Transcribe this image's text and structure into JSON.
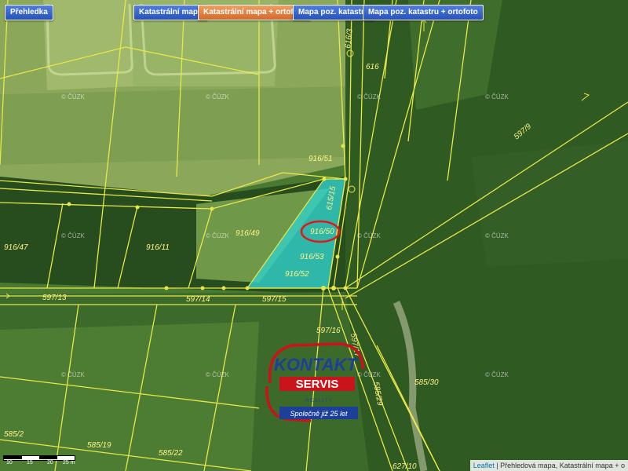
{
  "buttons": {
    "overview": "Přehledka",
    "cadastral": "Katastrální mapa",
    "cadastral_ortho": "Katastrální mapa + ortofoto",
    "cadastral_pos": "Mapa poz. katastru",
    "cadastral_pos_ortho": "Mapa poz. katastru + ortofoto"
  },
  "parcels": [
    "616/3",
    "616",
    "916/51",
    "615/15",
    "916/49",
    "916/50",
    "916/47",
    "916/11",
    "916/53",
    "916/52",
    "597/13",
    "597/14",
    "597/15",
    "597/16",
    "597/9",
    "597/17",
    "585/29",
    "585/30",
    "585/2",
    "585/19",
    "585/22",
    "627/10"
  ],
  "watermark": "© ČÚZK",
  "logo": {
    "line1": "KONTAKT",
    "line2": "SERVIS",
    "line3": "R E A L I T Y",
    "tagline": "Společně již 25 let"
  },
  "scale": {
    "labels": [
      "10",
      "15",
      "20",
      "25 m"
    ]
  },
  "attribution": {
    "link": "Leaflet",
    "text": " | Přehledová mapa, Katastrální mapa + o"
  },
  "colors": {
    "parcel_line": "#e8e84a",
    "highlight_fill": "#32d2cc",
    "highlight_ring": "#e01818",
    "button_blue": "#2f5cc4",
    "button_orange": "#e07a38"
  }
}
